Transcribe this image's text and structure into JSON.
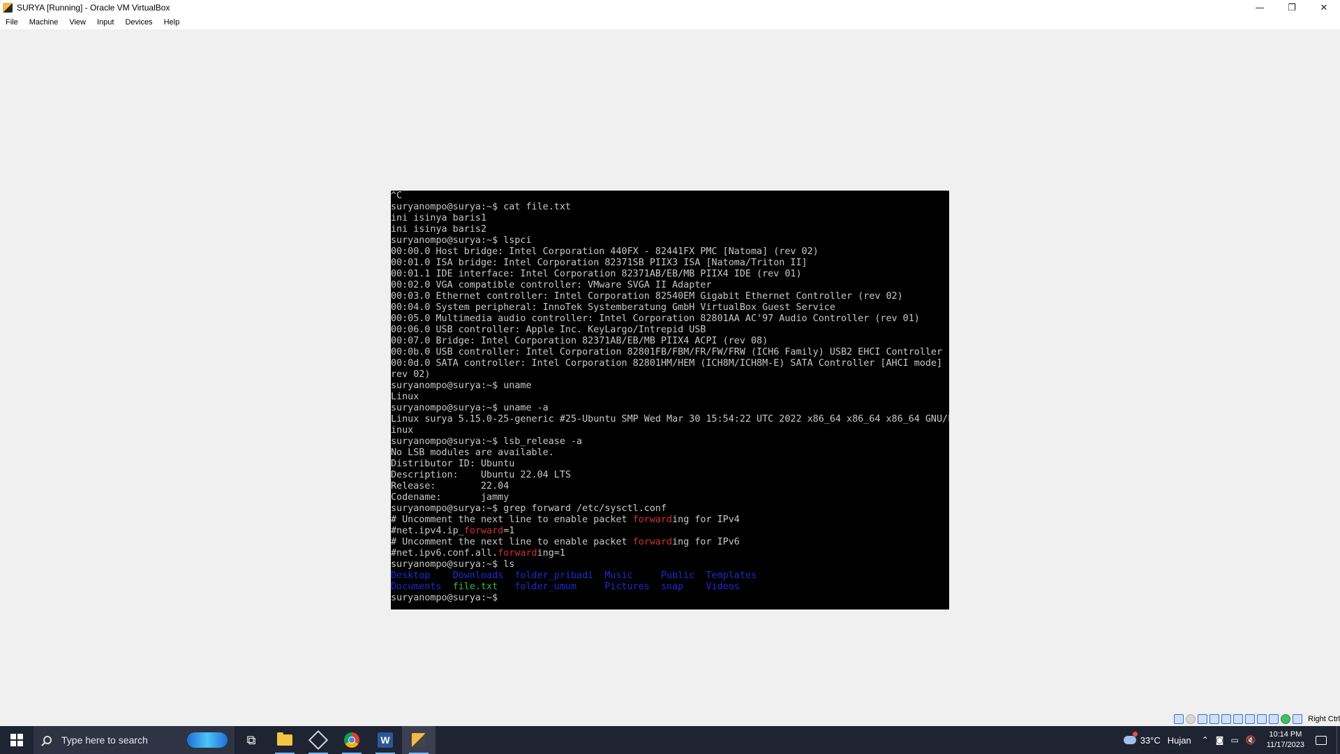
{
  "window": {
    "title": "SURYA [Running] - Oracle VM VirtualBox",
    "controls": {
      "minimize": "—",
      "restore": "❐",
      "close": "✕"
    }
  },
  "menu": [
    "File",
    "Machine",
    "View",
    "Input",
    "Devices",
    "Help"
  ],
  "terminal": {
    "lines": [
      "^C",
      "suryanompo@surya:~$ cat file.txt",
      "ini isinya baris1",
      "ini isinya baris2",
      "suryanompo@surya:~$ lspci",
      "00:00.0 Host bridge: Intel Corporation 440FX - 82441FX PMC [Natoma] (rev 02)",
      "00:01.0 ISA bridge: Intel Corporation 82371SB PIIX3 ISA [Natoma/Triton II]",
      "00:01.1 IDE interface: Intel Corporation 82371AB/EB/MB PIIX4 IDE (rev 01)",
      "00:02.0 VGA compatible controller: VMware SVGA II Adapter",
      "00:03.0 Ethernet controller: Intel Corporation 82540EM Gigabit Ethernet Controller (rev 02)",
      "00:04.0 System peripheral: InnoTek Systemberatung GmbH VirtualBox Guest Service",
      "00:05.0 Multimedia audio controller: Intel Corporation 82801AA AC'97 Audio Controller (rev 01)",
      "00:06.0 USB controller: Apple Inc. KeyLargo/Intrepid USB",
      "00:07.0 Bridge: Intel Corporation 82371AB/EB/MB PIIX4 ACPI (rev 08)",
      "00:0b.0 USB controller: Intel Corporation 82801FB/FBM/FR/FW/FRW (ICH6 Family) USB2 EHCI Controller",
      "00:0d.0 SATA controller: Intel Corporation 82801HM/HEM (ICH8M/ICH8M-E) SATA Controller [AHCI mode] (",
      "rev 02)",
      "suryanompo@surya:~$ uname",
      "Linux",
      "suryanompo@surya:~$ uname -a",
      "Linux surya 5.15.0-25-generic #25-Ubuntu SMP Wed Mar 30 15:54:22 UTC 2022 x86_64 x86_64 x86_64 GNU/L",
      "inux",
      "suryanompo@surya:~$ lsb_release -a",
      "No LSB modules are available.",
      "Distributor ID: Ubuntu",
      "Description:    Ubuntu 22.04 LTS",
      "Release:        22.04",
      "Codename:       jammy",
      "suryanompo@surya:~$ grep forward /etc/sysctl.conf"
    ],
    "grep_lines": [
      {
        "before": "# Uncomment the next line to enable packet ",
        "match": "forward",
        "after": "ing for IPv4"
      },
      {
        "before": "#net.ipv4.ip_",
        "match": "forward",
        "after": "=1"
      },
      {
        "before": "# Uncomment the next line to enable packet ",
        "match": "forward",
        "after": "ing for IPv6"
      },
      {
        "before": "#net.ipv6.conf.all.",
        "match": "forward",
        "after": "ing=1"
      }
    ],
    "ls_command": "suryanompo@surya:~$ ls",
    "ls_row1": [
      {
        "name": "Desktop",
        "pad": "    ",
        "kind": "dir"
      },
      {
        "name": "Downloads",
        "pad": "  ",
        "kind": "dir"
      },
      {
        "name": "folder_pribadi",
        "pad": "  ",
        "kind": "dir"
      },
      {
        "name": "Music",
        "pad": "     ",
        "kind": "dir"
      },
      {
        "name": "Public",
        "pad": "  ",
        "kind": "dir"
      },
      {
        "name": "Templates",
        "pad": "",
        "kind": "dir"
      }
    ],
    "ls_row2": [
      {
        "name": "Documents",
        "pad": "  ",
        "kind": "dir"
      },
      {
        "name": "file.txt",
        "pad": "   ",
        "kind": "file"
      },
      {
        "name": "folder_umum",
        "pad": "     ",
        "kind": "dir"
      },
      {
        "name": "Pictures",
        "pad": "  ",
        "kind": "dir"
      },
      {
        "name": "snap",
        "pad": "    ",
        "kind": "dir"
      },
      {
        "name": "Videos",
        "pad": "",
        "kind": "dir"
      }
    ],
    "prompt": "suryanompo@surya:~$ "
  },
  "statusbar": {
    "host_key": "Right Ctrl"
  },
  "taskbar": {
    "search_placeholder": "Type here to search",
    "weather_temp": "33°C",
    "weather_desc": "Hujan",
    "time": "10:14 PM",
    "date": "11/17/2023",
    "word_letter": "W"
  },
  "colors": {
    "terminal_bg": "#000000",
    "terminal_text": "#c8c8c8",
    "grep_match": "#d23131",
    "ls_dir": "#1c2bd9",
    "ls_file": "#2fbf2f",
    "taskbar_bg": "#1f2433"
  }
}
